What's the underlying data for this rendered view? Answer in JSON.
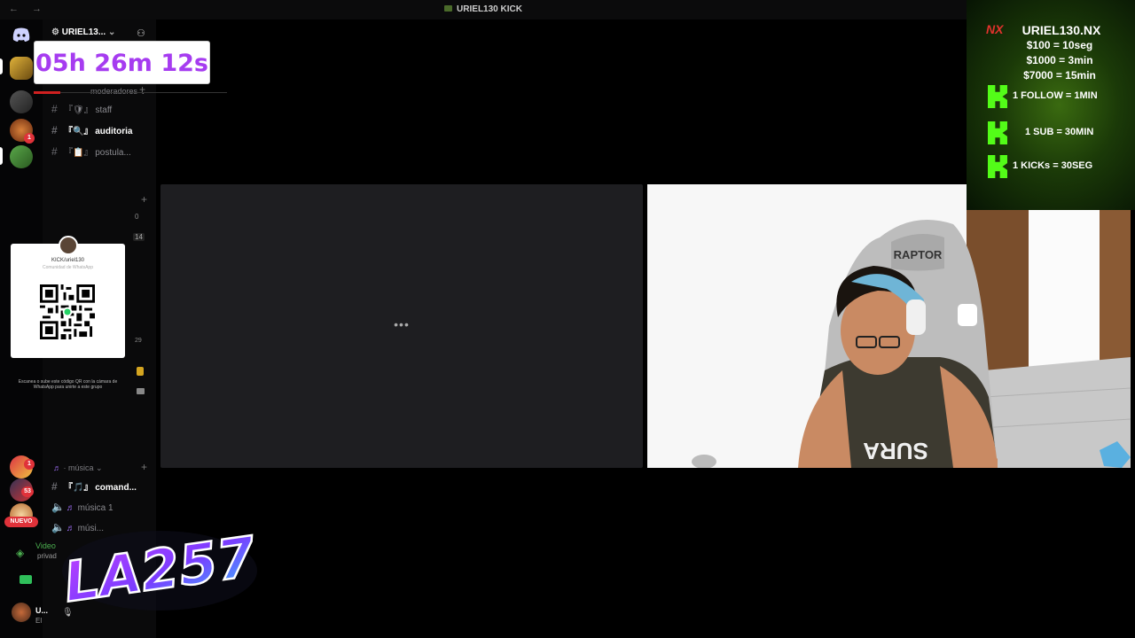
{
  "titlebar": {
    "title": "URIEL130 KICK",
    "nav": "← →"
  },
  "timer": {
    "text": "05h 26m 12s"
  },
  "server": {
    "name": "URIEL13..."
  },
  "channels": {
    "category_mods": "moderadores",
    "items": [
      {
        "prefix": "『🛡』",
        "label": "staff"
      },
      {
        "prefix": "『🔍』",
        "label": "auditoria"
      },
      {
        "prefix": "『📋』",
        "label": "postula..."
      }
    ],
    "category_music": "música",
    "music_items": [
      {
        "prefix": "『🎵』",
        "label": "comand..."
      },
      {
        "label": "música 1"
      },
      {
        "label": "músi..."
      }
    ]
  },
  "side_counts": {
    "a": "0",
    "b": "14",
    "c": "29"
  },
  "qr": {
    "name": "KICK/uriel130",
    "sub": "Comunidad de WhatsApp",
    "caption": "Escanea o sube este código QR con la cámara de WhatsApp para unirte a este grupo"
  },
  "rail": {
    "badge1": "1",
    "badge2": "1",
    "badge3": "53",
    "new_label": "NUEVO"
  },
  "voice": {
    "label": "Video",
    "sub": "privad"
  },
  "user": {
    "name": "U...",
    "status": "El"
  },
  "tile": {
    "dots": "•••"
  },
  "overlay": {
    "nx": "NX",
    "title": "URIEL130.NX",
    "rates": [
      "$100 = 10seg",
      "$1000 = 3min",
      "$7000 = 15min"
    ],
    "kick_rows": [
      "1 FOLLOW = 1MIN",
      "1 SUB = 30MIN",
      "1 KICKs = 30SEG"
    ],
    "accent": "#53fc18"
  },
  "webcam": {
    "chair_brand": "RAPTOR",
    "shirt_text": "SURA"
  },
  "logo": {
    "text": "LA257"
  }
}
